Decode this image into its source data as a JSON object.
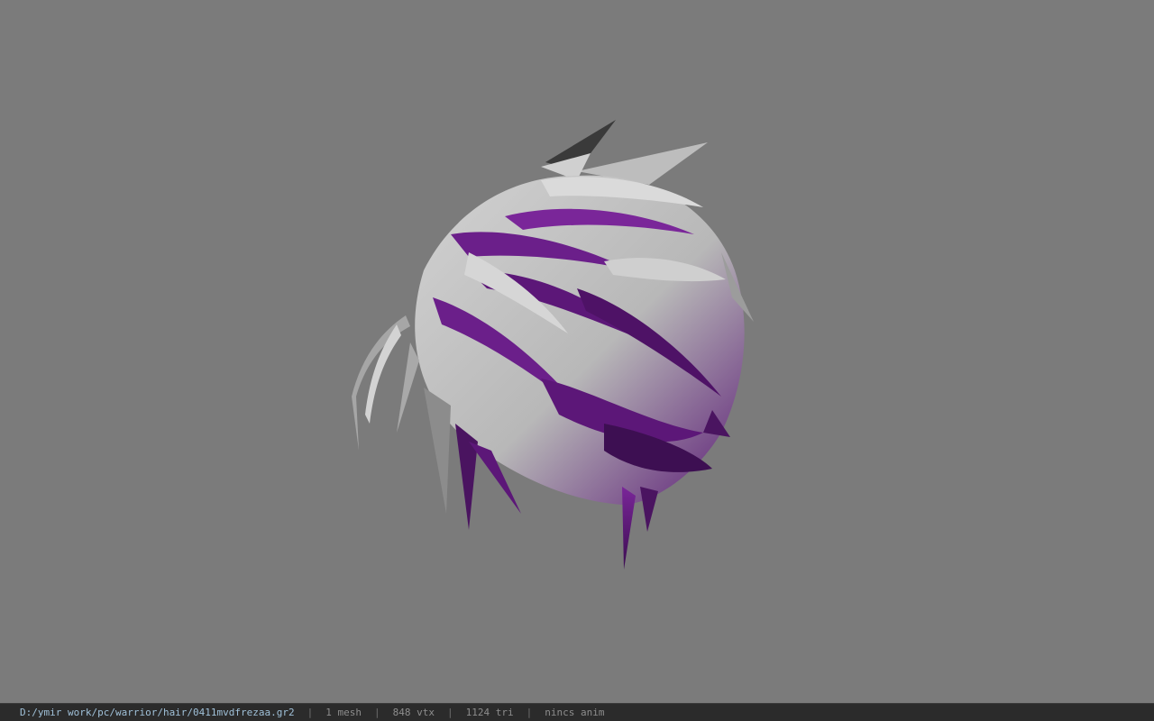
{
  "viewport": {
    "background": "#7b7b7b",
    "model": "hair-mesh",
    "colors": {
      "base": "#c9c9c9",
      "shadow": "#9a9a9a",
      "accent": "#6b1f8a",
      "accent_dark": "#3d0f52"
    }
  },
  "statusbar": {
    "path": "D:/ymir work/pc/warrior/hair/0411mvdfrezaa.gr2",
    "meshes": "1 mesh",
    "vertices": "848 vtx",
    "triangles": "1124 tri",
    "anim": "nincs anim",
    "separator": "|"
  }
}
